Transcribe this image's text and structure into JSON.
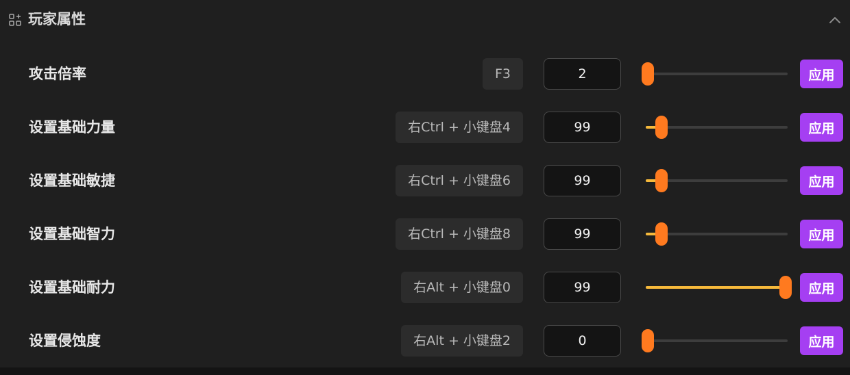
{
  "header": {
    "title": "玩家属性",
    "icon": "category-add-icon",
    "collapse_icon": "chevron-up-icon"
  },
  "colors": {
    "apply": "#a53ff2",
    "thumb": "#ff7a1f",
    "fill": "#f6b93b"
  },
  "rows": [
    {
      "label": "攻击倍率",
      "hotkey": "F3",
      "value": "2",
      "level": 0.0,
      "apply_label": "应用"
    },
    {
      "label": "设置基础力量",
      "hotkey": "右Ctrl + 小键盘4",
      "value": "99",
      "level": 0.1,
      "apply_label": "应用"
    },
    {
      "label": "设置基础敏捷",
      "hotkey": "右Ctrl + 小键盘6",
      "value": "99",
      "level": 0.1,
      "apply_label": "应用"
    },
    {
      "label": "设置基础智力",
      "hotkey": "右Ctrl + 小键盘8",
      "value": "99",
      "level": 0.1,
      "apply_label": "应用"
    },
    {
      "label": "设置基础耐力",
      "hotkey": "右Alt + 小键盘0",
      "value": "99",
      "level": 1.0,
      "apply_label": "应用"
    },
    {
      "label": "设置侵蚀度",
      "hotkey": "右Alt + 小键盘2",
      "value": "0",
      "level": 0.0,
      "apply_label": "应用"
    }
  ]
}
